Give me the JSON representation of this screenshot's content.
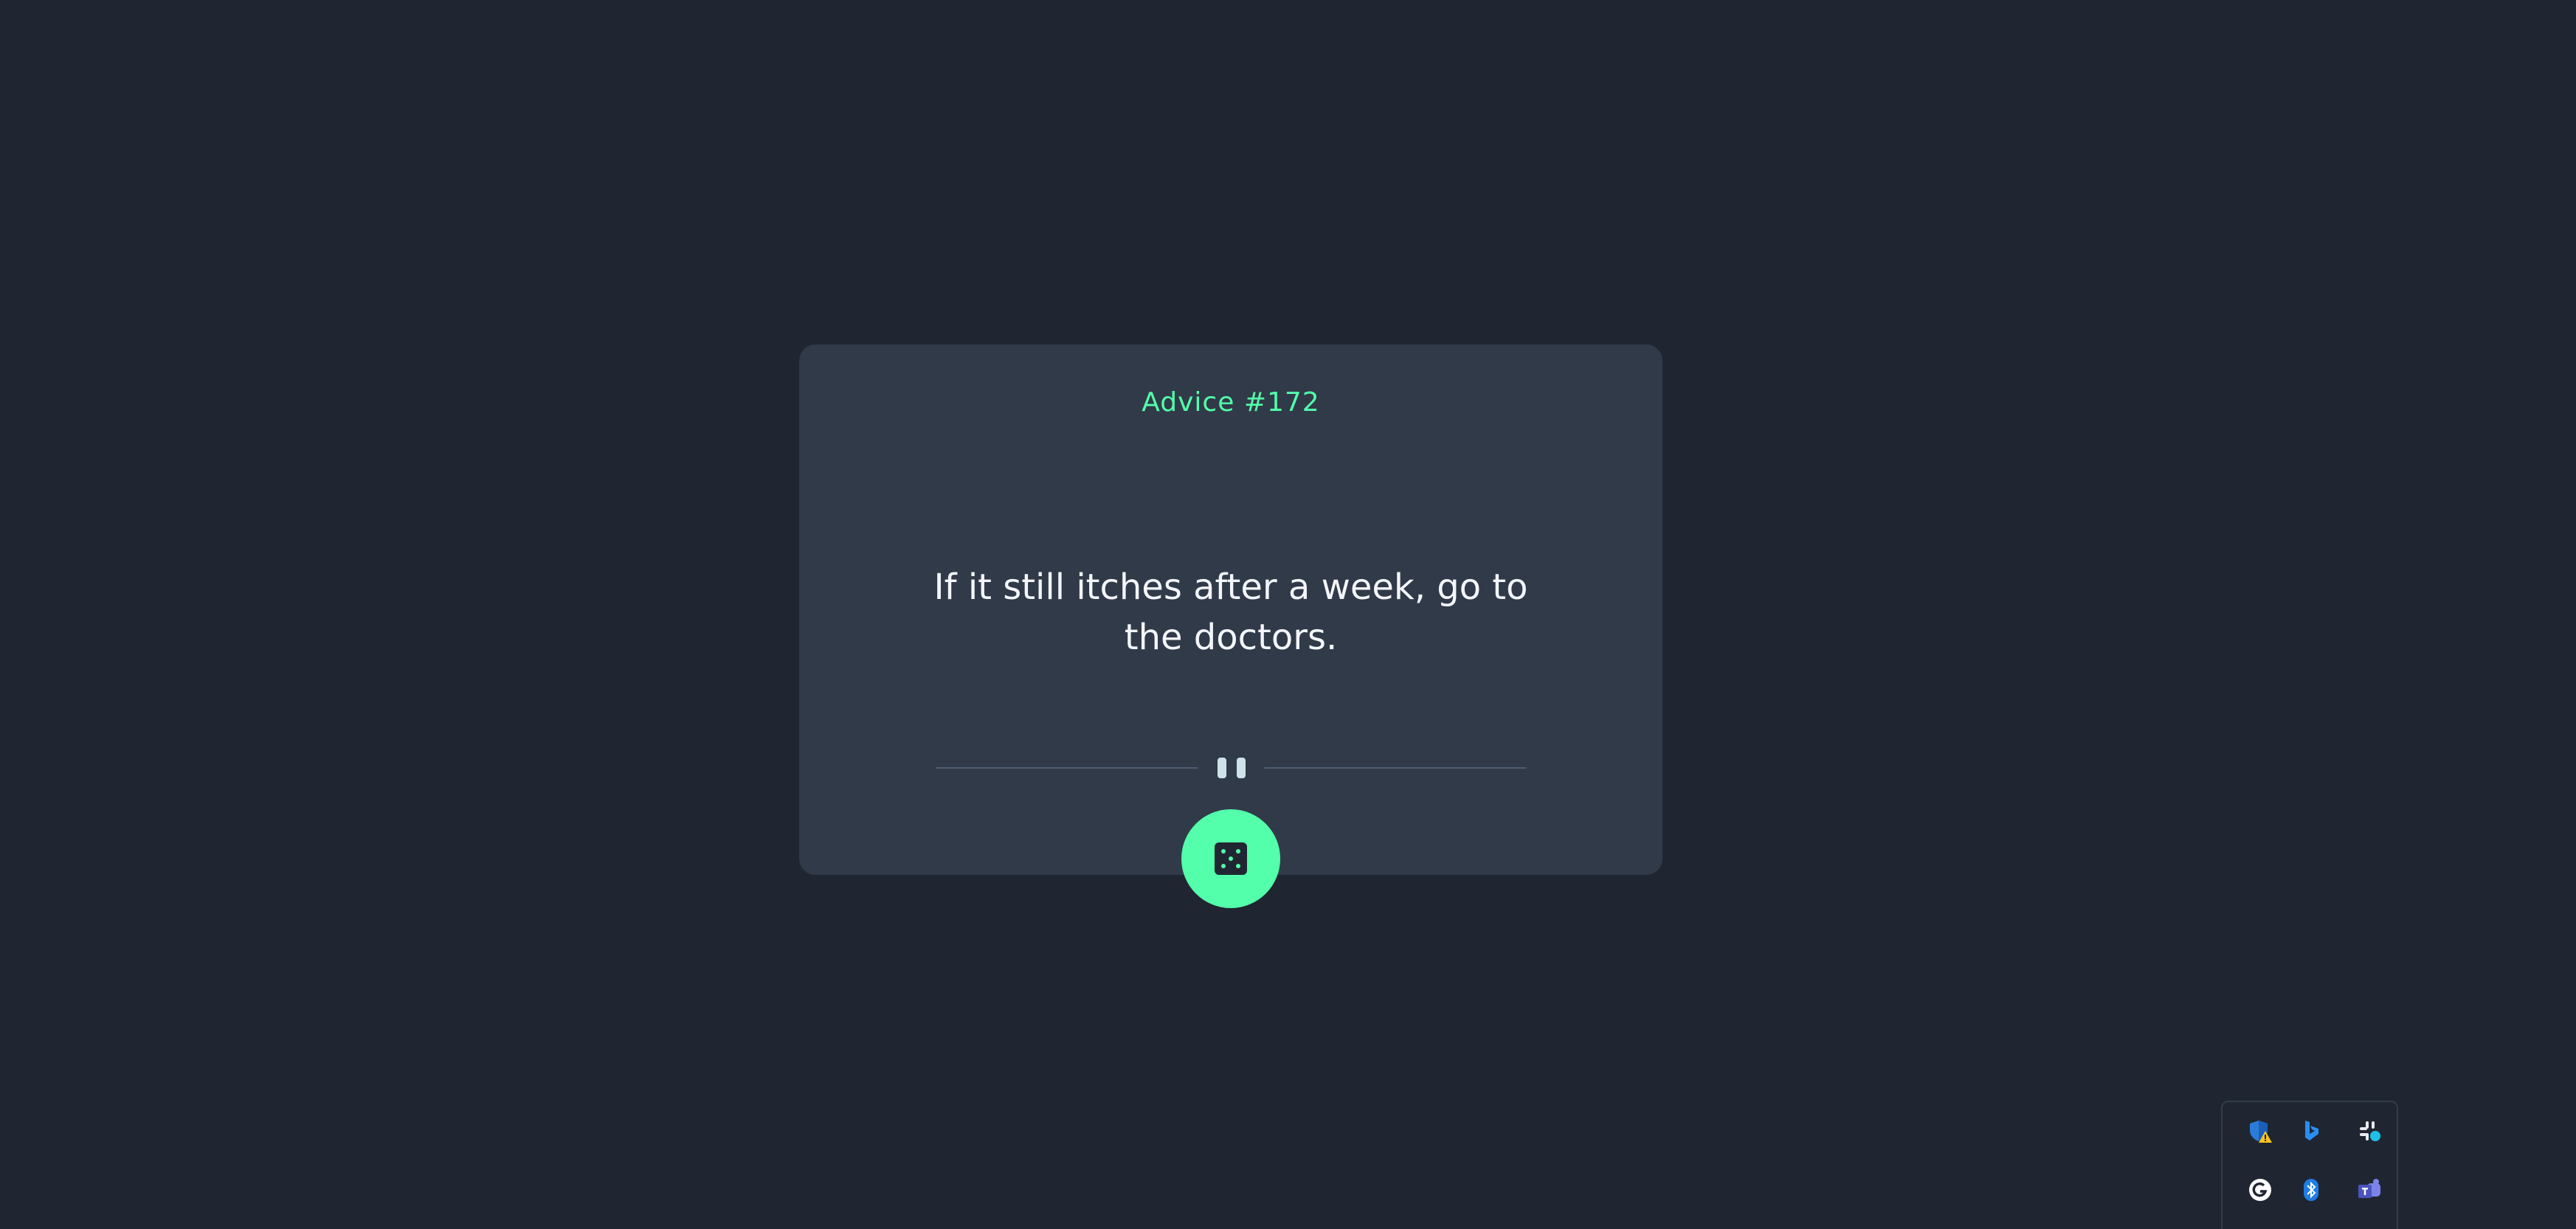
{
  "advice_card": {
    "advice_label": "Advice #172",
    "advice_text": "If it still itches after a week, go to the doctors."
  },
  "colors": {
    "background": "#1f2631",
    "card": "#313a48",
    "accent": "#53ffaa",
    "divider": "#4f5d74",
    "text": "#f3f6fb"
  },
  "icons": {
    "divider_icon": "pause-icon",
    "button_icon": "dice-icon"
  },
  "system_tray": {
    "icons": [
      "security-warning-icon",
      "bing-icon",
      "slack-icon",
      "grammarly-icon",
      "bluetooth-icon",
      "teams-icon"
    ]
  }
}
